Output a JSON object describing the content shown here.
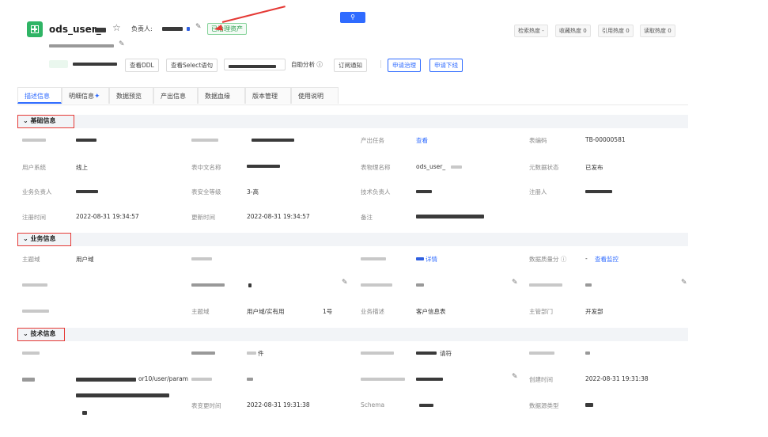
{
  "header": {
    "title": "ods_user_",
    "owner_label": "负责人:",
    "governed_tag": "已治理资产",
    "search_icon_glyph": "⚲",
    "metrics": [
      "检索热度 -",
      "收藏热度 0",
      "引用热度 0",
      "读取热度 0"
    ]
  },
  "toolbar": {
    "view_ddl": "查看DDL",
    "view_select": "查看Select语句",
    "auto_analysis": "自助分析 ⓘ",
    "subscribe": "订阅通知",
    "apply_governance": "申请治理",
    "apply_offline": "申请下线"
  },
  "tabs": [
    "描述信息",
    "明细信息",
    "数据预览",
    "产出信息",
    "数据血缘",
    "版本管理",
    "使用说明"
  ],
  "sections": {
    "basic": "基础信息",
    "business": "业务信息",
    "technical": "技术信息"
  },
  "basic": {
    "output_task_label": "产出任务",
    "output_task_value": "查看",
    "table_code_label": "表编码",
    "table_code_value": "TB-00000581",
    "user_system_label": "用户系统",
    "user_system_value": "线上",
    "cn_name_label": "表中文名称",
    "phys_name_label": "表物理名称",
    "phys_name_value": "ods_user_",
    "meta_status_label": "元数据状态",
    "meta_status_value": "已发布",
    "biz_owner_label": "业务负责人",
    "security_label": "表安全等级",
    "security_value": "3-高",
    "tech_owner_label": "技术负责人",
    "registrant_label": "注册人",
    "reg_time_label": "注册时间",
    "reg_time_value": "2022-08-31 19:34:57",
    "update_time_label": "更新时间",
    "update_time_value": "2022-08-31 19:34:57",
    "remark_label": "备注"
  },
  "business": {
    "subject_label": "主题域",
    "subject_value": "用户域",
    "quality_label": "数据质量分 ⓘ",
    "quality_value": "-",
    "quality_link": "查看监控",
    "link_suffix": "详情",
    "subject2_label": "主题域",
    "subject2_value": "用户域/实有用",
    "subject2_suffix": "1号",
    "biz_desc_label": "业务描述",
    "biz_desc_value": "客户信息表",
    "dept_label": "主管部门",
    "dept_value": "开发部"
  },
  "technical": {
    "file_suffix": "件",
    "format_suffix": "请符",
    "path_value": "or10/user/param",
    "created_label": "创建时间",
    "created_value": "2022-08-31 19:31:38",
    "change_time_label": "表变更时间",
    "change_time_value": "2022-08-31 19:31:38",
    "schema_label": "Schema",
    "source_type_label": "数据源类型"
  },
  "colors": {
    "accent": "#2f6bff",
    "annotation": "#e53935",
    "brand": "#2fb465"
  }
}
